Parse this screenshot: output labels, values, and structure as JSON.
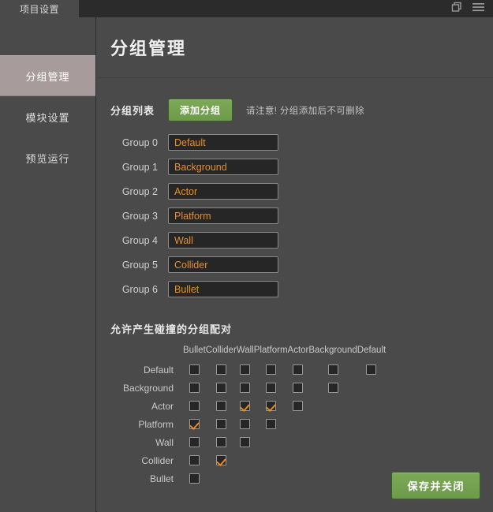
{
  "titlebar": {
    "tab_label": "项目设置",
    "icons": [
      {
        "name": "duplicate-windows-icon",
        "glyph": "copy"
      },
      {
        "name": "hamburger-menu-icon",
        "glyph": "menu"
      }
    ]
  },
  "sidebar": {
    "items": [
      {
        "label": "分组管理",
        "active": true
      },
      {
        "label": "模块设置",
        "active": false
      },
      {
        "label": "预览运行",
        "active": false
      }
    ]
  },
  "main": {
    "page_title": "分组管理",
    "group_list": {
      "label": "分组列表",
      "add_button": "添加分组",
      "note": "请注意! 分组添加后不可删除",
      "rows": [
        {
          "label": "Group 0",
          "value": "Default"
        },
        {
          "label": "Group 1",
          "value": "Background"
        },
        {
          "label": "Group 2",
          "value": "Actor"
        },
        {
          "label": "Group 3",
          "value": "Platform"
        },
        {
          "label": "Group 4",
          "value": "Wall"
        },
        {
          "label": "Group 5",
          "value": "Collider"
        },
        {
          "label": "Group 6",
          "value": "Bullet"
        }
      ]
    },
    "matrix": {
      "title": "允许产生碰撞的分组配对",
      "columns": [
        "Bullet",
        "Collider",
        "Wall",
        "Platform",
        "Actor",
        "Background",
        "Default"
      ],
      "rows": [
        "Default",
        "Background",
        "Actor",
        "Platform",
        "Wall",
        "Collider",
        "Bullet"
      ],
      "cells": [
        [
          0,
          0,
          0,
          0,
          0,
          0,
          0
        ],
        [
          0,
          0,
          0,
          0,
          0,
          0,
          null
        ],
        [
          0,
          0,
          1,
          1,
          0,
          null,
          null
        ],
        [
          1,
          0,
          0,
          0,
          null,
          null,
          null
        ],
        [
          0,
          0,
          0,
          null,
          null,
          null,
          null
        ],
        [
          0,
          1,
          null,
          null,
          null,
          null,
          null
        ],
        [
          0,
          null,
          null,
          null,
          null,
          null,
          null
        ]
      ]
    },
    "save_button": "保存并关闭"
  },
  "colors": {
    "accent_orange": "#e88f2a",
    "check_orange": "#ed8b1f",
    "green_button": "#7ba956",
    "panel_bg": "#4a4a4a",
    "titlebar_bg": "#2b2b2b",
    "active_item": "#a89b9b"
  }
}
